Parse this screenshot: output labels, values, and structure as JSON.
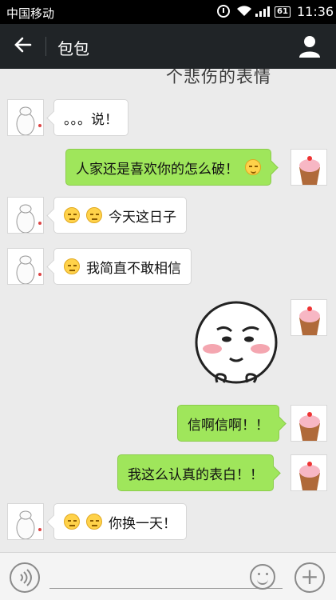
{
  "status_bar": {
    "carrier": "中国移动",
    "battery": "61",
    "time": "11:36"
  },
  "header": {
    "title": "包包",
    "back_icon": "arrow-left-icon",
    "profile_icon": "person-icon"
  },
  "caption_cutoff": "个悲伤的表情",
  "messages": [
    {
      "side": "left",
      "text": "。。。说！",
      "emojis": []
    },
    {
      "side": "right",
      "text": "人家还是喜欢你的怎么破！",
      "emojis_after": [
        "smile"
      ]
    },
    {
      "side": "left",
      "text": "今天这日子",
      "emojis": [
        "unamused",
        "unamused"
      ]
    },
    {
      "side": "left",
      "text": "我简直不敢相信",
      "emojis": [
        "unamused"
      ]
    },
    {
      "side": "right",
      "type": "sticker",
      "sticker": "shy-face-sticker"
    },
    {
      "side": "right",
      "text": "信啊信啊！！"
    },
    {
      "side": "right",
      "text": "我这么认真的表白！！"
    },
    {
      "side": "left",
      "text": "你换一天！",
      "emojis": [
        "unamused",
        "unamused"
      ]
    }
  ],
  "colors": {
    "right_bubble": "#9fe65b",
    "left_bubble": "#ffffff",
    "header_bg": "#202427",
    "chat_bg": "#ebebeb"
  }
}
